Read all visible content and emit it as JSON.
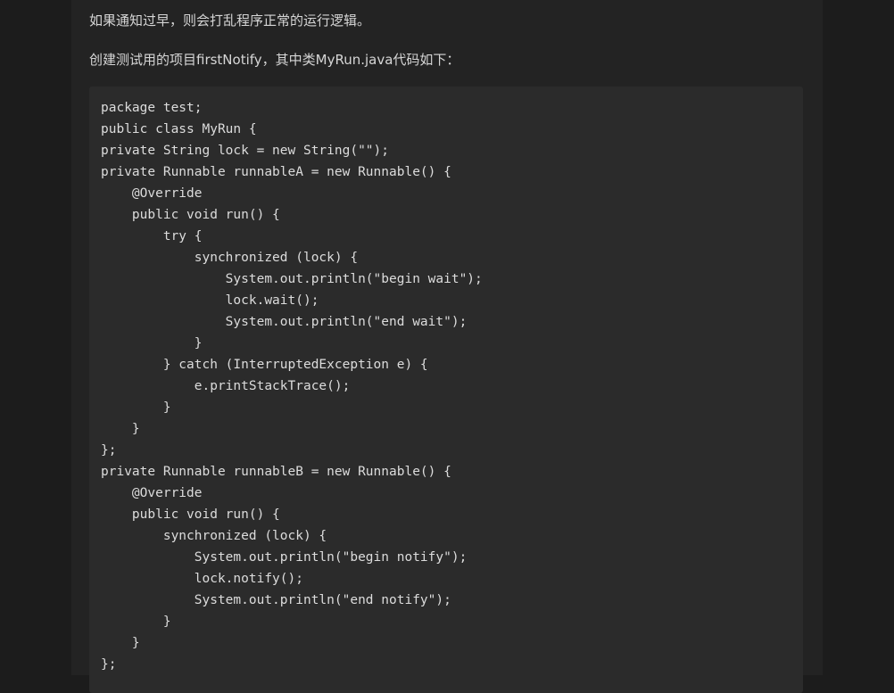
{
  "article": {
    "paragraphs": [
      "如果通知过早，则会打乱程序正常的运行逻辑。",
      "创建测试用的项目firstNotify，其中类MyRun.java代码如下："
    ],
    "code_lines": [
      "package test;",
      "public class MyRun {",
      "private String lock = new String(\"\");",
      "private Runnable runnableA = new Runnable() {",
      "    @Override",
      "    public void run() {",
      "        try {",
      "            synchronized (lock) {",
      "                System.out.println(\"begin wait\");",
      "                lock.wait();",
      "                System.out.println(\"end wait\");",
      "            }",
      "        } catch (InterruptedException e) {",
      "            e.printStackTrace();",
      "        }",
      "    }",
      "};",
      "private Runnable runnableB = new Runnable() {",
      "    @Override",
      "    public void run() {",
      "        synchronized (lock) {",
      "            System.out.println(\"begin notify\");",
      "            lock.notify();",
      "            System.out.println(\"end notify\");",
      "        }",
      "    }",
      "};"
    ]
  }
}
